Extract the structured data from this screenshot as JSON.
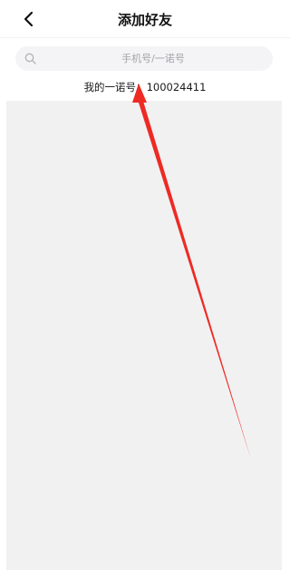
{
  "header": {
    "title": "添加好友"
  },
  "search": {
    "placeholder": "手机号/一诺号",
    "value": ""
  },
  "my_id": {
    "label": "我的一诺号：",
    "value": "100024411"
  },
  "colors": {
    "annotation_arrow": "#ee2a24",
    "content_background": "#f1f1f2",
    "search_background": "#f4f4f6"
  },
  "icons": {
    "back": "chevron-left-icon",
    "search": "search-icon"
  }
}
